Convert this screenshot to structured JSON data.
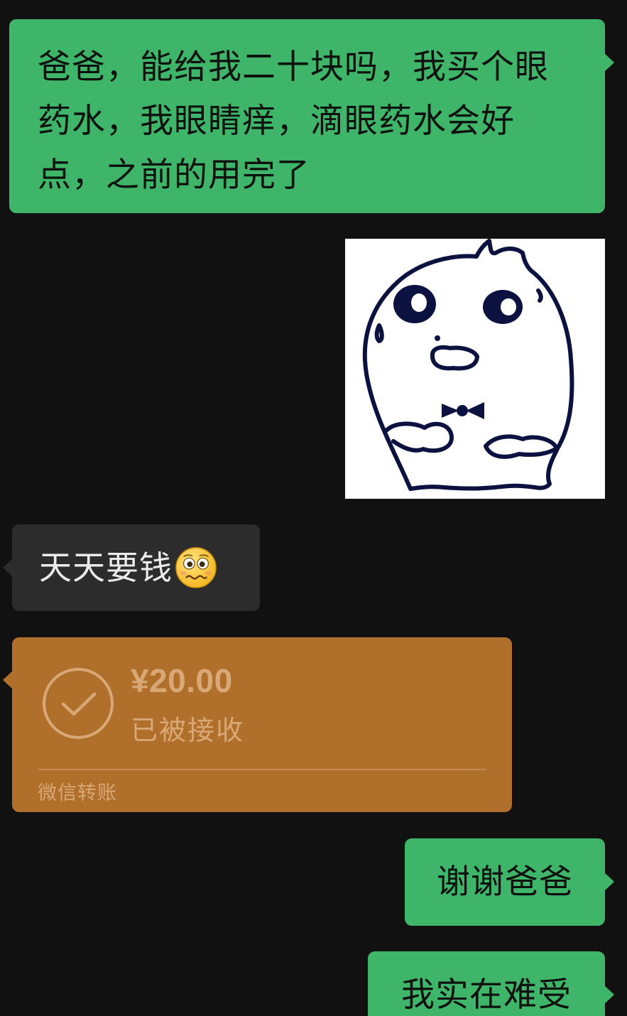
{
  "messages": [
    {
      "id": "m1",
      "side": "sent",
      "text": "爸爸，能给我二十块吗，我买个眼药水，我眼睛痒，滴眼药水会好点，之前的用完了"
    },
    {
      "id": "sticker",
      "side": "sent",
      "type": "sticker",
      "icon": "shocked-bun-sticker"
    },
    {
      "id": "m2",
      "side": "received",
      "text": "天天要钱",
      "emoji": "woozy-face-emoji"
    },
    {
      "id": "m3",
      "side": "sent",
      "text": "谢谢爸爸"
    },
    {
      "id": "m4",
      "side": "sent",
      "text": "我实在难受"
    }
  ],
  "transfer": {
    "amount": "¥20.00",
    "status": "已被接收",
    "footer": "微信转账",
    "icon": "check-circle-icon"
  },
  "colors": {
    "background": "#111111",
    "sent_bubble": "#3fb56a",
    "received_bubble": "#2c2c2c",
    "transfer_card": "#b06f2a",
    "transfer_text": "#d9a877"
  }
}
